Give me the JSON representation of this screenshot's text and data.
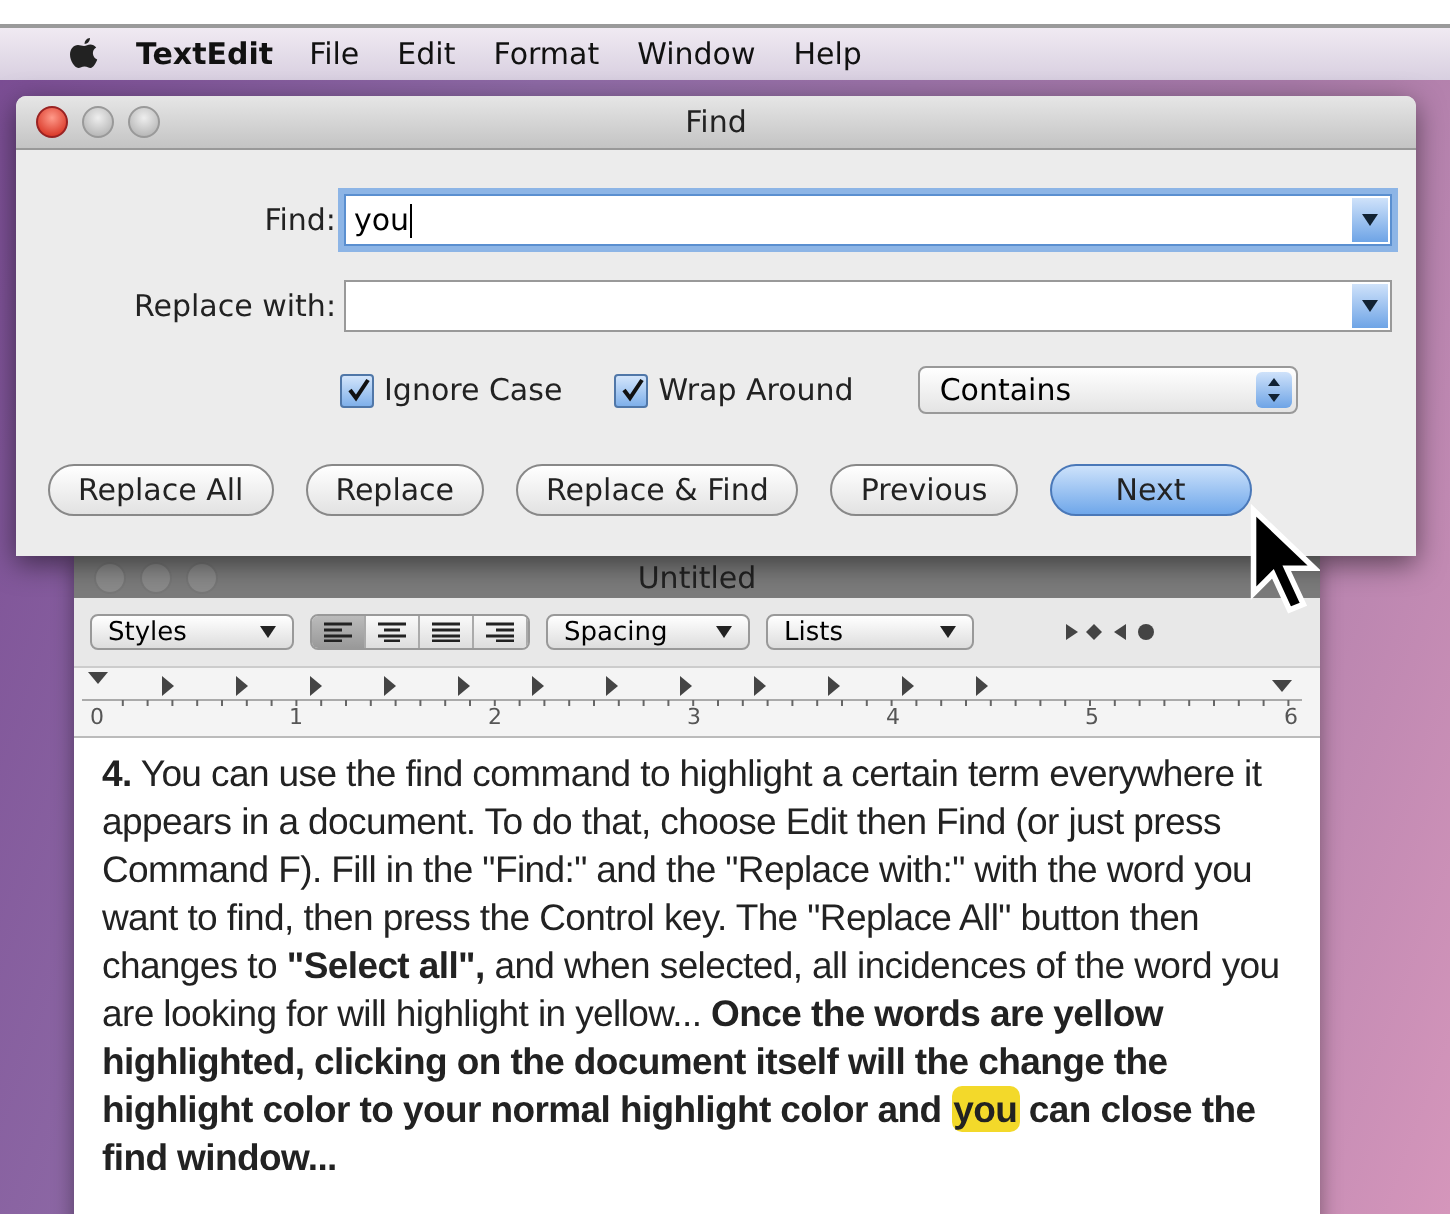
{
  "menu_bar": {
    "app": "TextEdit",
    "items": [
      "File",
      "Edit",
      "Format",
      "Window",
      "Help"
    ]
  },
  "find_window": {
    "title": "Find",
    "find": {
      "label": "Find:",
      "value": "you"
    },
    "replace": {
      "label": "Replace with:"
    },
    "options": [
      {
        "label": "Ignore Case",
        "checked": true
      },
      {
        "label": "Wrap Around",
        "checked": true
      }
    ],
    "match_mode": "Contains",
    "buttons": [
      {
        "label": "Replace All",
        "default": false
      },
      {
        "label": "Replace",
        "default": false
      },
      {
        "label": "Replace & Find",
        "default": false
      },
      {
        "label": "Previous",
        "default": false
      },
      {
        "label": "Next",
        "default": true
      }
    ]
  },
  "document_window": {
    "title": "Untitled",
    "styles": "Styles",
    "alignment": [
      {
        "kind": "left",
        "selected": true
      },
      {
        "kind": "center",
        "selected": false
      },
      {
        "kind": "justify",
        "selected": false
      },
      {
        "kind": "right",
        "selected": false
      }
    ],
    "spacing": "Spacing",
    "lists": "Lists",
    "ruler": [
      "0",
      "1",
      "2",
      "3",
      "4",
      "5",
      "6"
    ],
    "paragraph": [
      {
        "text": "4.",
        "bold": true,
        "highlighted": false
      },
      {
        "text": "  You can use the find command to highlight a certain term everywhere it appears in a document.  To do that, choose Edit then Find (or just press Command F).  Fill in the \"Find:\" and the \"Replace with:\" with the word you want to find, then press the Control key. The \"Replace All\" button then changes to ",
        "bold": false,
        "highlighted": false
      },
      {
        "text": "\"Select all\",",
        "bold": true,
        "highlighted": false
      },
      {
        "text": "  and when selected, all incidences of the word you are looking for will highlight in yellow...   ",
        "bold": false,
        "highlighted": false
      },
      {
        "text": "Once the words are yellow highlighted,  clicking on the document itself will the change the highlight color to your normal highlight color and ",
        "bold": true,
        "highlighted": false
      },
      {
        "text": "you",
        "bold": true,
        "highlighted": true
      },
      {
        "text": " can close the find window...",
        "bold": true,
        "highlighted": false
      }
    ]
  }
}
